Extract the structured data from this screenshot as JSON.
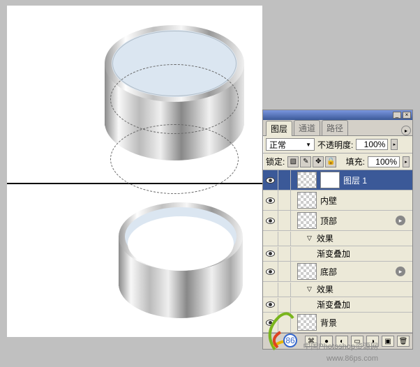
{
  "panel": {
    "tabs": {
      "layers": "图层",
      "channels": "通道",
      "paths": "路径"
    },
    "blend_label": "正常",
    "opacity_label": "不透明度:",
    "opacity_value": "100%",
    "lock_label": "锁定:",
    "fill_label": "填充:",
    "fill_value": "100%"
  },
  "layers": [
    {
      "name": "图层 1",
      "selected": true,
      "masked": true
    },
    {
      "name": "内壁"
    },
    {
      "name": "顶部",
      "fx": true
    },
    {
      "sub": 1,
      "name": "效果",
      "tri": "▽"
    },
    {
      "sub": 2,
      "name": "渐变叠加",
      "eye": true
    },
    {
      "name": "底部",
      "fx": true
    },
    {
      "sub": 1,
      "name": "效果",
      "tri": "▽"
    },
    {
      "sub": 2,
      "name": "渐变叠加",
      "eye": true
    },
    {
      "name": "背景"
    }
  ],
  "watermark": {
    "line1": "中国Photoshop资源网",
    "line2": "www.86ps.com"
  }
}
